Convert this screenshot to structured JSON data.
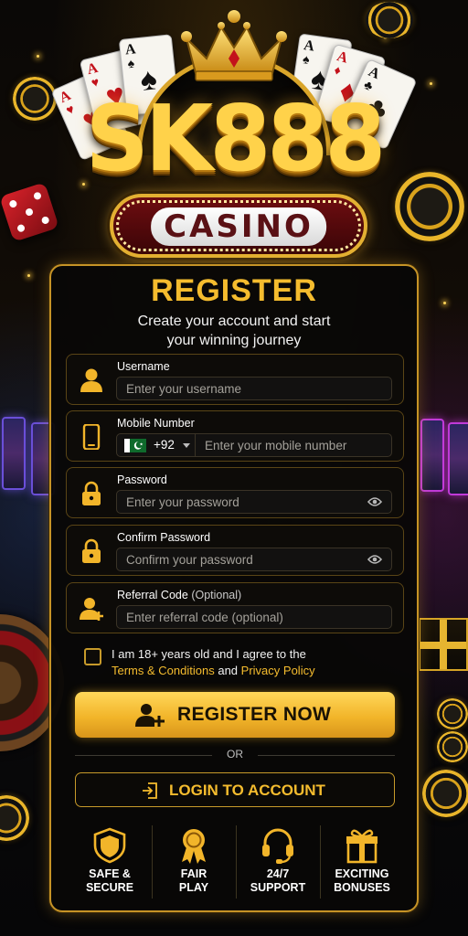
{
  "brand": {
    "logo_text": "SK888",
    "badge_text": "CASINO"
  },
  "register": {
    "title": "REGISTER",
    "subtitle_line1": "Create your account and start",
    "subtitle_line2": "your winning journey"
  },
  "fields": {
    "username": {
      "label": "Username",
      "placeholder": "Enter your username",
      "icon": "user-icon"
    },
    "mobile": {
      "label": "Mobile Number",
      "country_code": "+92",
      "country_flag": "pakistan-flag-icon",
      "placeholder": "Enter your mobile number",
      "icon": "phone-icon"
    },
    "password": {
      "label": "Password",
      "placeholder": "Enter your password",
      "icon": "lock-icon"
    },
    "confirm_password": {
      "label": "Confirm Password",
      "placeholder": "Confirm your password",
      "icon": "lock-icon"
    },
    "referral": {
      "label": "Referral Code",
      "label_suffix": "(Optional)",
      "placeholder": "Enter referral code (optional)",
      "icon": "add-user-icon"
    }
  },
  "agreement": {
    "line1": "I am 18+ years old and I agree to the",
    "terms_link": "Terms & Conditions",
    "and": "and",
    "privacy_link": "Privacy Policy",
    "checked": false
  },
  "buttons": {
    "register": "REGISTER NOW",
    "or": "OR",
    "login": "LOGIN TO ACCOUNT"
  },
  "features": [
    {
      "line1": "SAFE &",
      "line2": "SECURE",
      "icon": "shield-icon"
    },
    {
      "line1": "FAIR",
      "line2": "PLAY",
      "icon": "medal-icon"
    },
    {
      "line1": "24/7",
      "line2": "SUPPORT",
      "icon": "headset-icon"
    },
    {
      "line1": "EXCITING",
      "line2": "BONUSES",
      "icon": "gift-icon"
    }
  ],
  "colors": {
    "gold": "#f5bc2e",
    "panel_border": "#c69326",
    "background": "#050403",
    "button_text": "#1a1204"
  }
}
